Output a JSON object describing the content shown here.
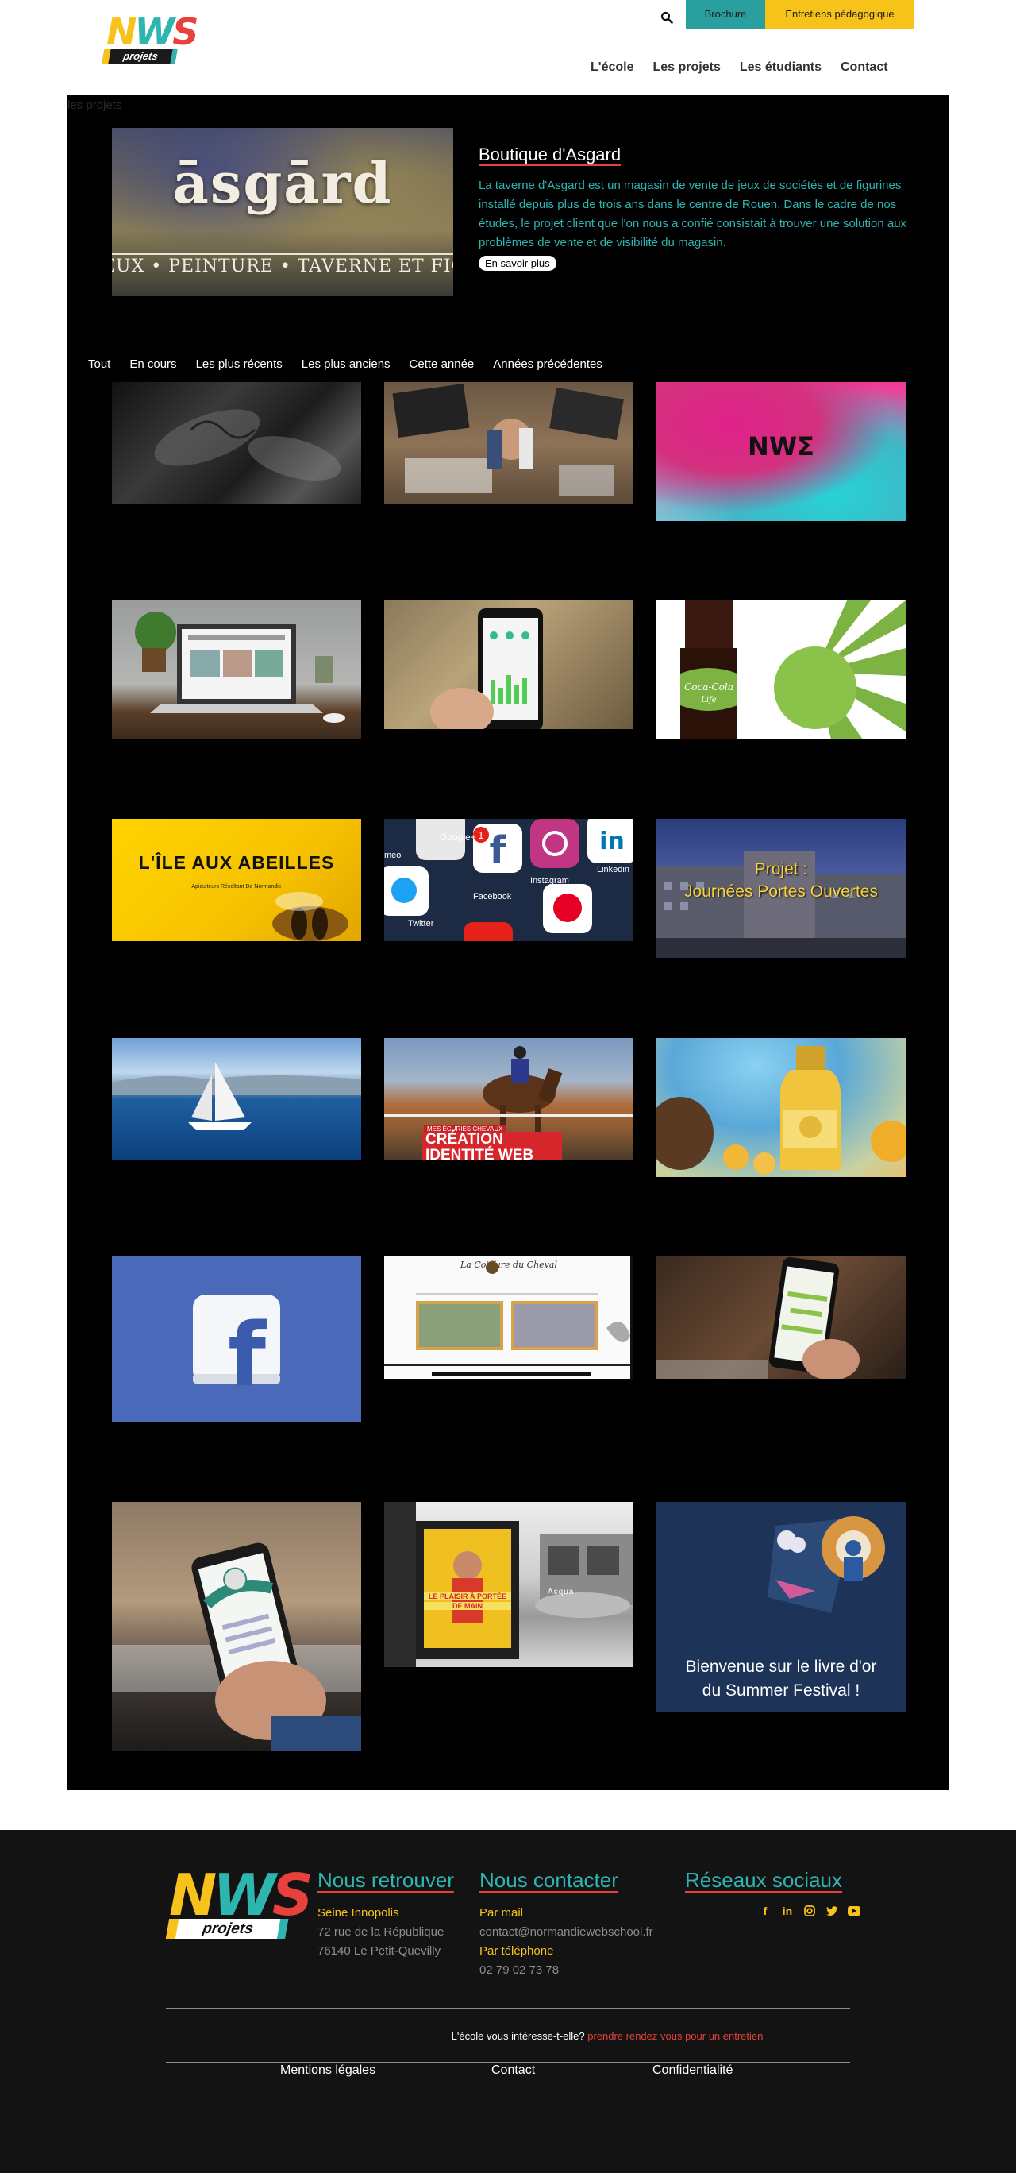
{
  "header": {
    "logo_text": "NWS",
    "logo_tag": "projets",
    "brochure_label": "Brochure",
    "entretiens_label": "Entretiens pédagogique",
    "nav": [
      "L'école",
      "Les projets",
      "Les étudiants",
      "Contact"
    ]
  },
  "main": {
    "page_label": "les projets",
    "featured": {
      "image_word": "āsgārd",
      "image_subtitle": "EUX • PEINTURE • TAVERNE ET FIGURINE",
      "title": "Boutique d'Asgard",
      "description": "La taverne d'Asgard est un magasin de vente de jeux de sociétés et de figurines installé depuis plus de trois ans dans le centre de Rouen. Dans le cadre de nos études, le projet client que l'on nous a confié consistait à trouver une solution aux problèmes de vente et de visibilité du magasin.",
      "button_label": "En savoir plus"
    },
    "filters": [
      "Tout",
      "En cours",
      "Les plus récents",
      "Les plus anciens",
      "Cette année",
      "Années précédentes"
    ],
    "cards": {
      "nws": "NWƩ",
      "abeilles_title": "L'ÎLE AUX ABEILLES",
      "abeilles_sub": "Apiculteurs Récoltant De Normandie",
      "social_labels": [
        "Google+",
        "Facebook",
        "Instagram",
        "Linkedin",
        "Twitter",
        "meo"
      ],
      "jpo_line1": "Projet :",
      "jpo_line2": "Journées Portes Ouvertes",
      "horse_small": "MES ÉCURIES CHEVAUX",
      "horse_line1": "CRÉATION",
      "horse_line2": "IDENTITÉ WEB",
      "coiffure_title": "La Coiffure du Cheval",
      "poster_line1": "LE PLAISIR À PORTÉE",
      "poster_line2": "DE MAIN",
      "poster_brand": "Acqua",
      "summer_line1": "Bienvenue sur le livre d'or",
      "summer_line2": "du Summer Festival !",
      "coke_brand": "Coca-Cola",
      "coke_sub": "Life"
    }
  },
  "footer": {
    "logo_text": "NWS",
    "logo_tag": "projets",
    "retrouver_title": "Nous retrouver",
    "retrouver_place": "Seine Innopolis",
    "retrouver_addr1": "72 rue de la République",
    "retrouver_addr2": "76140 Le Petit-Quevilly",
    "contact_title": "Nous contacter",
    "mail_label": "Par mail",
    "mail": "contact@normandiewebschool.fr",
    "phone_label": "Par téléphone",
    "phone": "02 79 02 73 78",
    "social_title": "Réseaux sociaux",
    "cta_text": "L'école vous intéresse-t-elle?",
    "cta_link": "prendre rendez vous pour un entretien",
    "links": [
      "Mentions légales",
      "Contact",
      "Confidentialité"
    ]
  },
  "colors": {
    "yellow": "#f7c31a",
    "teal": "#2fb5b0",
    "red": "#e8403b",
    "panel": "#000000",
    "footer_bg": "#131313"
  }
}
